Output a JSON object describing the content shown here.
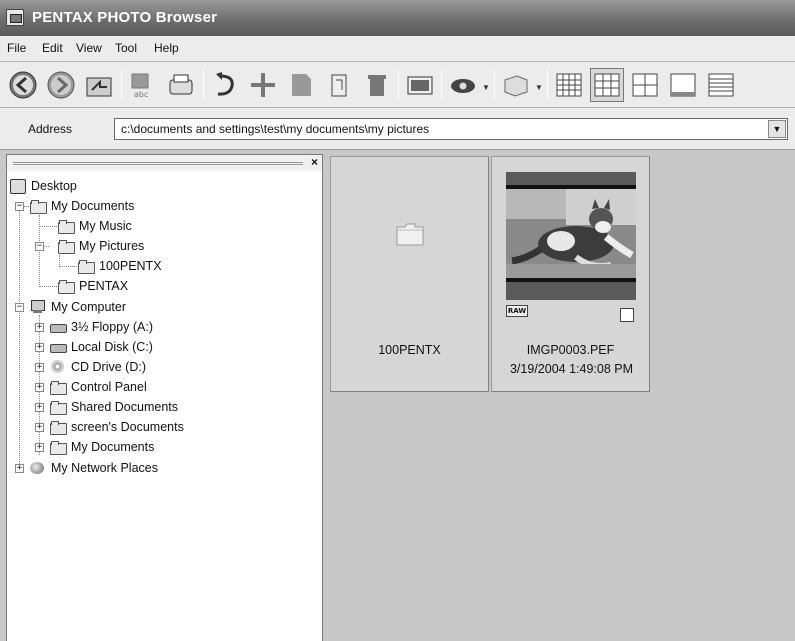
{
  "window": {
    "title": "PENTAX PHOTO Browser"
  },
  "menu": [
    "File",
    "Edit",
    "View",
    "Tool",
    "Help"
  ],
  "toolbar": {
    "buttons": [
      "back-icon",
      "forward-icon",
      "up-folder-icon",
      "rename-icon",
      "print-icon",
      "undo-icon",
      "move-icon",
      "copy-icon",
      "tag-icon",
      "delete-icon",
      "slideshow-icon",
      "view-mode-icon",
      "display-options-icon",
      "grid-large-icon",
      "grid-medium-icon",
      "grid-small-icon",
      "single-view-icon",
      "list-view-icon"
    ],
    "selected_view": "grid-medium-icon"
  },
  "address": {
    "label": "Address",
    "value": "c:\\documents and settings\\test\\my documents\\my pictures"
  },
  "tree": {
    "desktop": "Desktop",
    "my_documents": "My Documents",
    "my_music": "My Music",
    "my_pictures": "My Pictures",
    "pentx_100": "100PENTX",
    "pentax": "PENTAX",
    "my_computer": "My Computer",
    "floppy": "3½ Floppy (A:)",
    "local_disk": "Local Disk (C:)",
    "cd_drive": "CD Drive (D:)",
    "control_panel": "Control Panel",
    "shared_documents": "Shared Documents",
    "screens_documents": "screen's Documents",
    "my_documents_2": "My Documents",
    "network_places": "My Network Places"
  },
  "thumbnails": {
    "folder": {
      "name": "100PENTX"
    },
    "image": {
      "name": "IMGP0003.PEF",
      "date": "3/19/2004 1:49:08 PM",
      "badge": "RAW"
    }
  },
  "colors": {
    "titlebar": "#6e6e6e",
    "pane_bg": "#c8c8c8",
    "tile_bg": "#d6d6d6"
  }
}
